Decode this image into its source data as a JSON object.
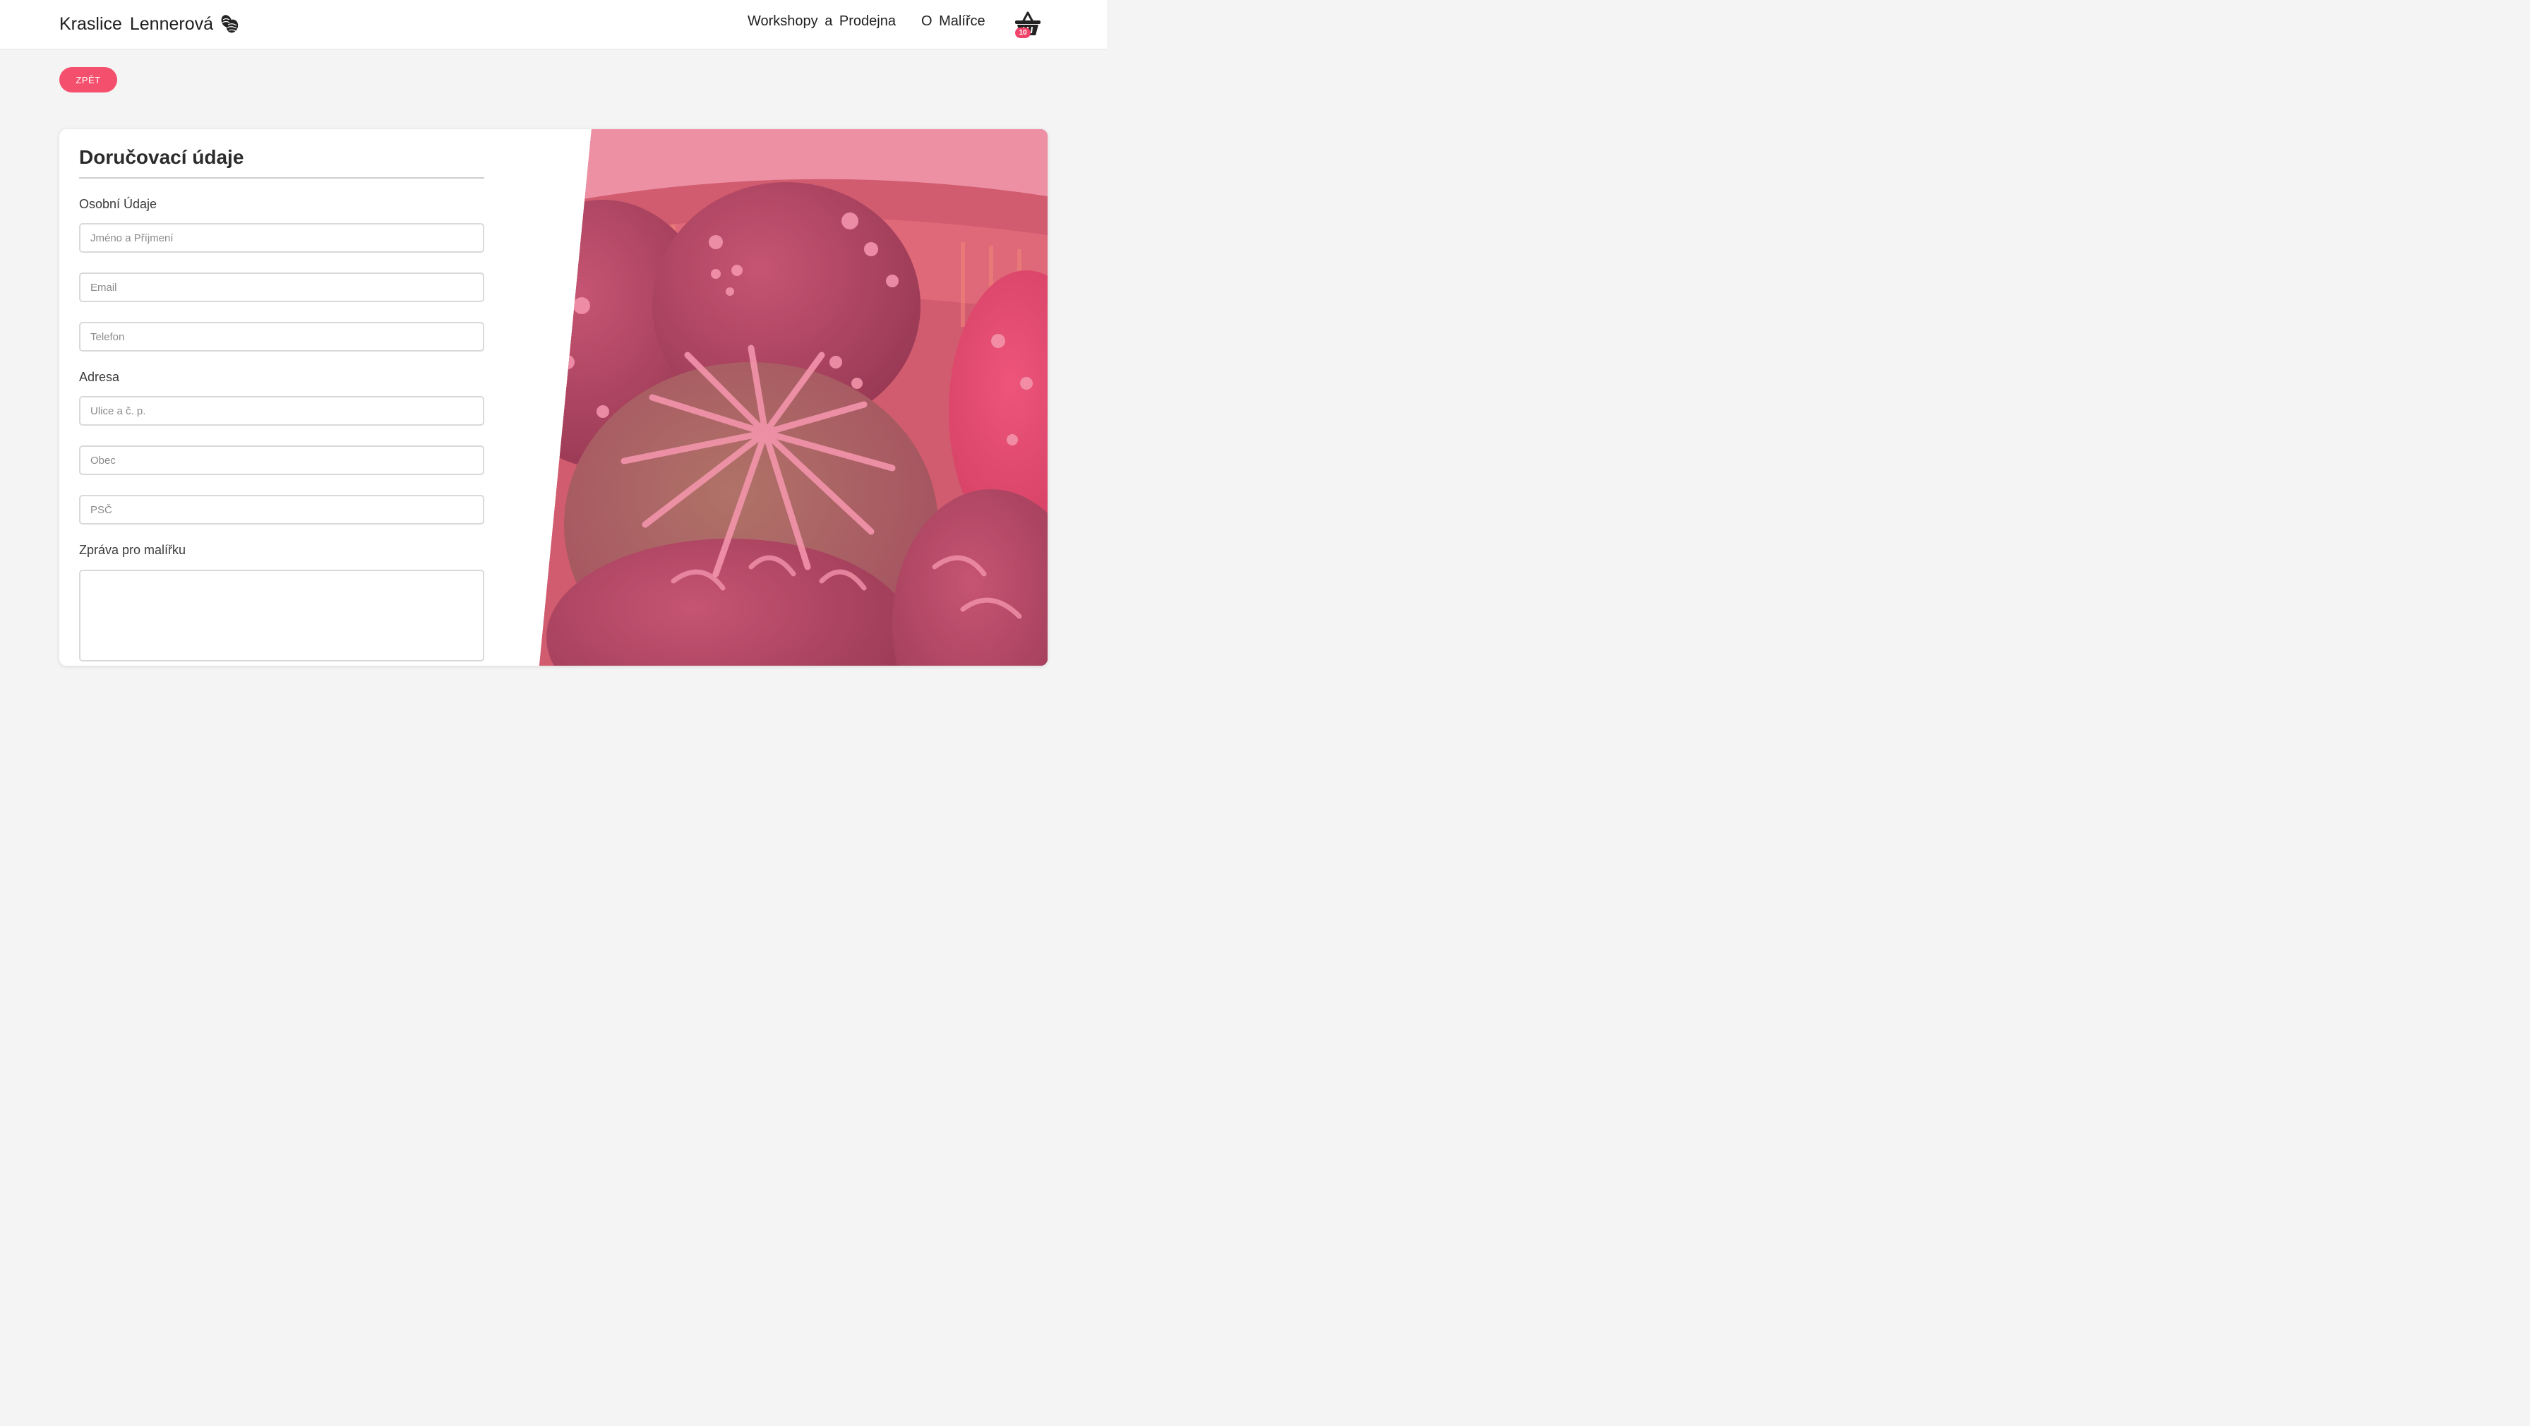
{
  "header": {
    "brand": "Kraslice Lennerová",
    "nav": [
      "Workshopy a Prodejna",
      "O Malířce"
    ],
    "cart_count": "10"
  },
  "back_button": "ZPĚT",
  "form": {
    "title": "Doručovací údaje",
    "personal_section": "Osobní Údaje",
    "name_placeholder": "Jméno a Příjmení",
    "email_placeholder": "Email",
    "phone_placeholder": "Telefon",
    "address_section": "Adresa",
    "street_placeholder": "Ulice a č. p.",
    "city_placeholder": "Obec",
    "zip_placeholder": "PSČ",
    "message_section": "Zpráva pro malířku",
    "message_value": ""
  },
  "colors": {
    "accent": "#f4506e",
    "badge": "#f0446b",
    "photo_tint": "#e8607f"
  },
  "icons": {
    "logo": "easter-eggs-icon",
    "cart": "basket-icon"
  }
}
